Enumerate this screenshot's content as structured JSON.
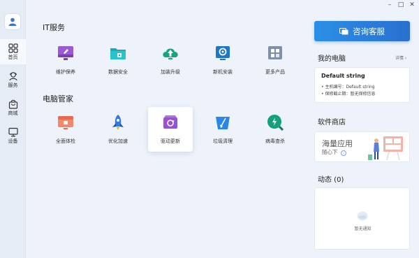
{
  "window": {
    "min": "–",
    "max": "□",
    "close": "✕"
  },
  "sidebar": {
    "items": [
      {
        "label": "首页",
        "icon": "home-grid-icon"
      },
      {
        "label": "服务",
        "icon": "service-icon"
      },
      {
        "label": "商城",
        "icon": "shopping-bag-icon"
      },
      {
        "label": "设备",
        "icon": "monitor-icon"
      }
    ]
  },
  "it_section": {
    "title": "IT服务",
    "items": [
      {
        "label": "维护保养",
        "icon": "maintenance-icon"
      },
      {
        "label": "数据安全",
        "icon": "data-security-icon"
      },
      {
        "label": "加装升级",
        "icon": "upgrade-icon"
      },
      {
        "label": "新机安装",
        "icon": "new-install-icon"
      },
      {
        "label": "更多产品",
        "icon": "more-products-icon"
      }
    ]
  },
  "pc_section": {
    "title": "电脑管家",
    "items": [
      {
        "label": "全面体检",
        "icon": "checkup-icon"
      },
      {
        "label": "优化加速",
        "icon": "rocket-icon"
      },
      {
        "label": "驱动更新",
        "icon": "driver-update-icon"
      },
      {
        "label": "垃圾清理",
        "icon": "cleanup-icon"
      },
      {
        "label": "病毒查杀",
        "icon": "antivirus-icon"
      }
    ]
  },
  "right": {
    "cs_button": "咨询客服",
    "my_pc": {
      "title": "我的电脑",
      "detail": "详情 ›",
      "name": "Default string",
      "serial": "• 主机编号：Default string",
      "warranty": "• 保修截止期：暂无保修信息"
    },
    "store": {
      "title": "软件商店",
      "main": "海量应用",
      "sub": "随心下"
    },
    "feed": {
      "title": "动态 (0)",
      "empty": "暂无通知"
    }
  },
  "colors": {
    "accent": "#2b7fe0",
    "bg": "#eef3fb"
  }
}
